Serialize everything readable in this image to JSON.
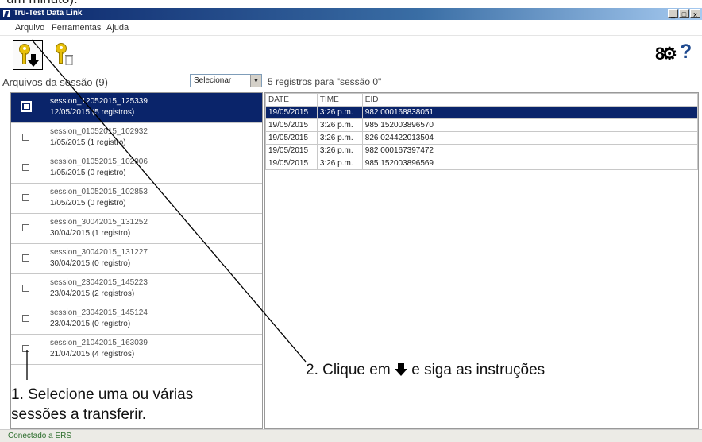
{
  "top_clip_text": "um minuto).",
  "window": {
    "title": "Tru-Test Data Link",
    "buttons": [
      "_",
      "□",
      "x"
    ]
  },
  "menu": [
    "Arquivo",
    "Ferramentas",
    "Ajuda"
  ],
  "toolbar": {
    "icons": [
      "transfer-download-icon",
      "delete-pin-icon",
      "settings-gear-icon",
      "help-icon"
    ],
    "help_glyph": "?",
    "gear_glyph": "8⚙"
  },
  "left": {
    "header": "Arquivos da sessão (9)",
    "select_value": "Selecionar",
    "sessions": [
      {
        "name": "session_12052015_125339",
        "info": "12/05/2015  (5 registros)",
        "selected": true
      },
      {
        "name": "session_01052015_102932",
        "info": "1/05/2015  (1 registro)",
        "selected": false
      },
      {
        "name": "session_01052015_102906",
        "info": "1/05/2015  (0 registro)",
        "selected": false
      },
      {
        "name": "session_01052015_102853",
        "info": "1/05/2015  (0 registro)",
        "selected": false
      },
      {
        "name": "session_30042015_131252",
        "info": "30/04/2015  (1 registro)",
        "selected": false
      },
      {
        "name": "session_30042015_131227",
        "info": "30/04/2015  (0 registro)",
        "selected": false
      },
      {
        "name": "session_23042015_145223",
        "info": "23/04/2015  (2 registros)",
        "selected": false
      },
      {
        "name": "session_23042015_145124",
        "info": "23/04/2015  (0 registro)",
        "selected": false
      },
      {
        "name": "session_21042015_163039",
        "info": "21/04/2015  (4 registros)",
        "selected": false
      }
    ]
  },
  "right": {
    "header": "5 registros para \"sessão 0\"",
    "columns": [
      "DATE",
      "TIME",
      "EID"
    ],
    "rows": [
      [
        "19/05/2015",
        "3:26 p.m.",
        "982 000168838051"
      ],
      [
        "19/05/2015",
        "3:26 p.m.",
        "985 152003896570"
      ],
      [
        "19/05/2015",
        "3:26 p.m.",
        "826 024422013504"
      ],
      [
        "19/05/2015",
        "3:26 p.m.",
        "982 000167397472"
      ],
      [
        "19/05/2015",
        "3:26 p.m.",
        "985 152003896569"
      ]
    ]
  },
  "status": "Conectado a ERS",
  "annotations": {
    "step1_line1": "1. Selecione uma ou várias",
    "step1_line2": "sessões a transferir.",
    "step2_prefix": "2. Clique em",
    "step2_suffix": "e siga as instruções"
  }
}
